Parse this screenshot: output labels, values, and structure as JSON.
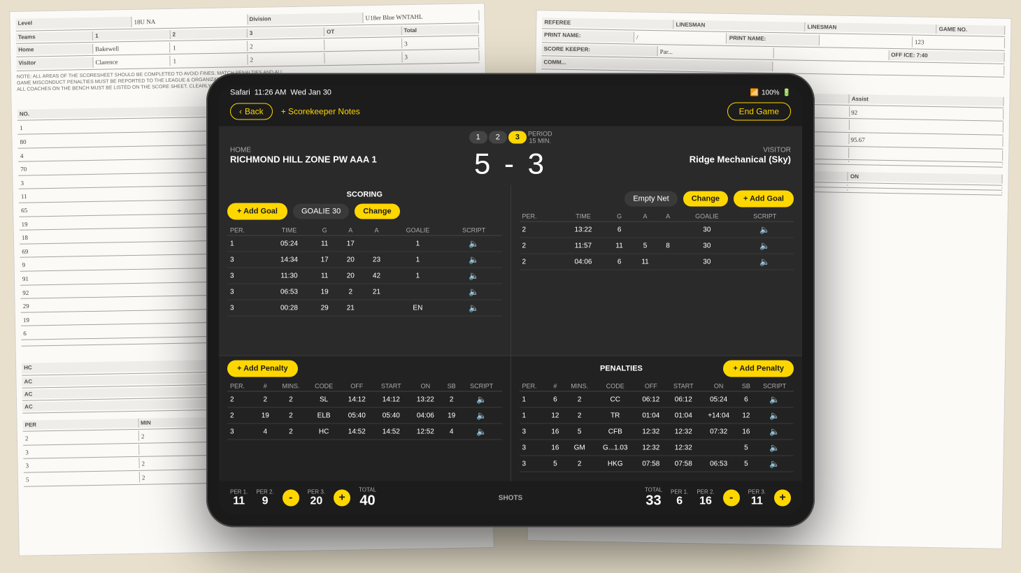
{
  "background": {
    "color": "#d0c9b8"
  },
  "statusBar": {
    "carrier": "Safari",
    "time": "11:26 AM",
    "date": "Wed Jan 30",
    "wifi": "WiFi",
    "battery": "100%"
  },
  "nav": {
    "back_label": "Back",
    "notes_label": "+ Scorekeeper Notes",
    "end_game_label": "End Game"
  },
  "header": {
    "home_label": "HOME",
    "home_team": "RICHMOND HILL ZONE PW AAA 1",
    "visitor_label": "VISITOR",
    "visitor_team": "Ridge Mechanical (Sky)",
    "score_home": "5",
    "score_dash": "-",
    "score_visitor": "3",
    "period_label": "PERIOD",
    "period_duration": "15 MIN.",
    "periods": [
      "1",
      "2",
      "3"
    ],
    "active_period": "3"
  },
  "scoring": {
    "title": "SCORING",
    "home": {
      "add_goal_label": "+ Add Goal",
      "goalie_label": "GOALIE 30",
      "change_label": "Change",
      "columns": [
        "PER.",
        "TIME",
        "G",
        "A",
        "A",
        "GOALIE",
        "SCRIPT"
      ],
      "rows": [
        {
          "per": "1",
          "time": "05:24",
          "g": "11",
          "a1": "17",
          "a2": "",
          "goalie": "1",
          "script": "🔈"
        },
        {
          "per": "3",
          "time": "14:34",
          "g": "17",
          "a1": "20",
          "a2": "23",
          "goalie": "1",
          "script": "🔈"
        },
        {
          "per": "3",
          "time": "11:30",
          "g": "11",
          "a1": "20",
          "a2": "42",
          "goalie": "1",
          "script": "🔈"
        },
        {
          "per": "3",
          "time": "06:53",
          "g": "19",
          "a1": "2",
          "a2": "21",
          "goalie": "",
          "script": "🔈"
        },
        {
          "per": "3",
          "time": "00:28",
          "g": "29",
          "a1": "21",
          "a2": "",
          "goalie": "EN",
          "script": "🔈"
        }
      ]
    },
    "visitor": {
      "empty_net_label": "Empty Net",
      "change_label": "Change",
      "add_goal_label": "+ Add Goal",
      "columns": [
        "PER.",
        "TIME",
        "G",
        "A",
        "A",
        "GOALIE",
        "SCRIPT"
      ],
      "rows": [
        {
          "per": "2",
          "time": "13:22",
          "g": "6",
          "a1": "",
          "a2": "",
          "goalie": "30",
          "script": "🔈"
        },
        {
          "per": "2",
          "time": "11:57",
          "g": "11",
          "a1": "5",
          "a2": "8",
          "goalie": "30",
          "script": "🔈"
        },
        {
          "per": "2",
          "time": "04:06",
          "g": "6",
          "a1": "11",
          "a2": "",
          "goalie": "30",
          "script": "🔈"
        }
      ]
    }
  },
  "penalties": {
    "title": "PENALTIES",
    "home": {
      "add_penalty_label": "+ Add Penalty",
      "columns": [
        "PER.",
        "#",
        "MINS.",
        "CODE",
        "OFF",
        "START",
        "ON",
        "SB",
        "SCRIPT"
      ],
      "rows": [
        {
          "per": "2",
          "num": "2",
          "mins": "2",
          "code": "SL",
          "off": "14:12",
          "start": "14:12",
          "on": "13:22",
          "sb": "2",
          "script": "🔈"
        },
        {
          "per": "2",
          "num": "19",
          "mins": "2",
          "code": "ELB",
          "off": "05:40",
          "start": "05:40",
          "on": "04:06",
          "sb": "19",
          "script": "🔈"
        },
        {
          "per": "3",
          "num": "4",
          "mins": "2",
          "code": "HC",
          "off": "14:52",
          "start": "14:52",
          "on": "12:52",
          "sb": "4",
          "script": "🔈"
        }
      ]
    },
    "visitor": {
      "add_penalty_label": "+ Add Penalty",
      "columns": [
        "PER.",
        "#",
        "MINS.",
        "CODE",
        "OFF",
        "START",
        "ON",
        "SB",
        "SCRIPT"
      ],
      "rows": [
        {
          "per": "1",
          "num": "6",
          "mins": "2",
          "code": "CC",
          "off": "06:12",
          "start": "06:12",
          "on": "05:24",
          "sb": "6",
          "script": "🔈"
        },
        {
          "per": "1",
          "num": "12",
          "mins": "2",
          "code": "TR",
          "off": "01:04",
          "start": "01:04",
          "on": "+14:04",
          "sb": "12",
          "script": "🔈"
        },
        {
          "per": "3",
          "num": "16",
          "mins": "5",
          "code": "CFB",
          "off": "12:32",
          "start": "12:32",
          "on": "07:32",
          "sb": "16",
          "script": "🔈"
        },
        {
          "per": "3",
          "num": "16",
          "mins": "GM",
          "code": "G...1.03",
          "off": "12:32",
          "start": "12:32",
          "on": "",
          "sb": "5",
          "script": "🔈"
        },
        {
          "per": "3",
          "num": "5",
          "mins": "2",
          "code": "HKG",
          "off": "07:58",
          "start": "07:58",
          "on": "06:53",
          "sb": "5",
          "script": "🔈"
        }
      ]
    }
  },
  "shots": {
    "label": "SHOTS",
    "home": {
      "per1_label": "PER 1.",
      "per1_value": "11",
      "per2_label": "PER 2.",
      "per2_value": "9",
      "per3_label": "PER 3.",
      "per3_value": "20",
      "total_label": "TOTAL",
      "total_value": "40",
      "minus_label": "-",
      "plus_label": "+"
    },
    "visitor": {
      "per1_label": "PER 1.",
      "per1_value": "6",
      "per2_label": "PER 2.",
      "per2_value": "16",
      "per3_label": "PER 3.",
      "per3_value": "11",
      "total_label": "TOTAL",
      "total_value": "33",
      "minus_label": "-",
      "plus_label": "+"
    }
  }
}
